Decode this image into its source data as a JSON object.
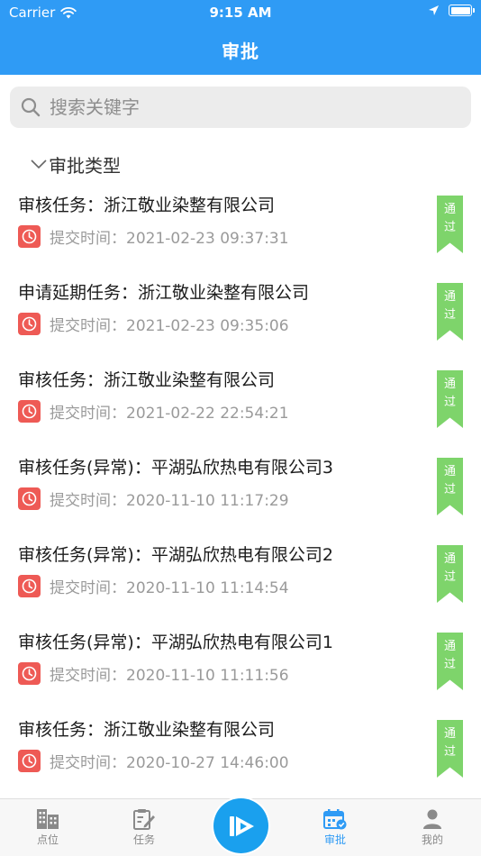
{
  "status_bar": {
    "carrier": "Carrier",
    "time": "9:15 AM"
  },
  "header": {
    "title": "审批"
  },
  "search": {
    "placeholder": "搜索关键字"
  },
  "section": {
    "title": "审批类型"
  },
  "items": [
    {
      "title": "审核任务：浙江敬业染整有限公司",
      "time_label": "提交时间：",
      "time": "2021-02-23 09:37:31",
      "badge": [
        "通",
        "过"
      ]
    },
    {
      "title": "申请延期任务：浙江敬业染整有限公司",
      "time_label": "提交时间：",
      "time": "2021-02-23 09:35:06",
      "badge": [
        "通",
        "过"
      ]
    },
    {
      "title": "审核任务：浙江敬业染整有限公司",
      "time_label": "提交时间：",
      "time": "2021-02-22 22:54:21",
      "badge": [
        "通",
        "过"
      ]
    },
    {
      "title": "审核任务(异常)：平湖弘欣热电有限公司3",
      "time_label": "提交时间：",
      "time": "2020-11-10 11:17:29",
      "badge": [
        "通",
        "过"
      ]
    },
    {
      "title": "审核任务(异常)：平湖弘欣热电有限公司2",
      "time_label": "提交时间：",
      "time": "2020-11-10 11:14:54",
      "badge": [
        "通",
        "过"
      ]
    },
    {
      "title": "审核任务(异常)：平湖弘欣热电有限公司1",
      "time_label": "提交时间：",
      "time": "2020-11-10 11:11:56",
      "badge": [
        "通",
        "过"
      ]
    },
    {
      "title": "审核任务：浙江敬业染整有限公司",
      "time_label": "提交时间：",
      "time": "2020-10-27 14:46:00",
      "badge": [
        "通",
        "过"
      ]
    }
  ],
  "tabbar": {
    "tabs": [
      {
        "label": "点位",
        "icon": "building-icon"
      },
      {
        "label": "任务",
        "icon": "task-edit-icon"
      },
      {
        "label": "审批",
        "icon": "calendar-approval-icon"
      },
      {
        "label": "我的",
        "icon": "person-icon"
      }
    ],
    "active": "审批",
    "center_icon": "play-logo-icon"
  },
  "colors": {
    "header": "#2f9bf5",
    "accent": "#2f9bf5",
    "badge": "#7ed46b",
    "clock": "#ee5a55",
    "center_button": "#1aa0ee"
  }
}
